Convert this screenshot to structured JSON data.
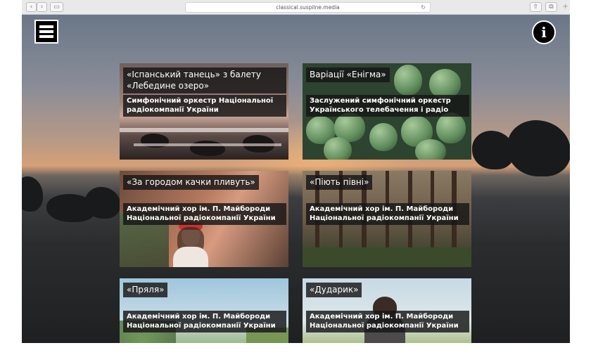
{
  "browser": {
    "url": "classical.suspilne.media",
    "back_icon": "chevron-left-icon",
    "forward_icon": "chevron-right-icon"
  },
  "header": {
    "menu_icon": "hamburger-icon",
    "info_label": "i"
  },
  "cards": [
    {
      "title": "«Іспанський танець» з балету «Лебедине озеро»",
      "performer": "Симфонічний оркестр Національної радіокомпанії України",
      "image": "sea-waves-rocks"
    },
    {
      "title": "Варіації «Енігма»",
      "performer": "Заслужений симфонічний оркестр Українського телебачення і радіо",
      "image": "green-pears"
    },
    {
      "title": "«За городом качки пливуть»",
      "performer": "Академічний хор ім. П. Майбороди Національної радіокомпанії України",
      "image": "woman-flower-crown"
    },
    {
      "title": "«Піють півні»",
      "performer": "Академічний хор ім. П. Майбороди Національної радіокомпанії України",
      "image": "pine-forest"
    },
    {
      "title": "«Пряля»",
      "performer": "Академічний хор ім. П. Майбороди Національної радіокомпанії України",
      "image": "meadow-sky"
    },
    {
      "title": "«Дударик»",
      "performer": "Академічний хор ім. П. Майбороди Національної радіокомпанії України",
      "image": "person-field"
    }
  ]
}
